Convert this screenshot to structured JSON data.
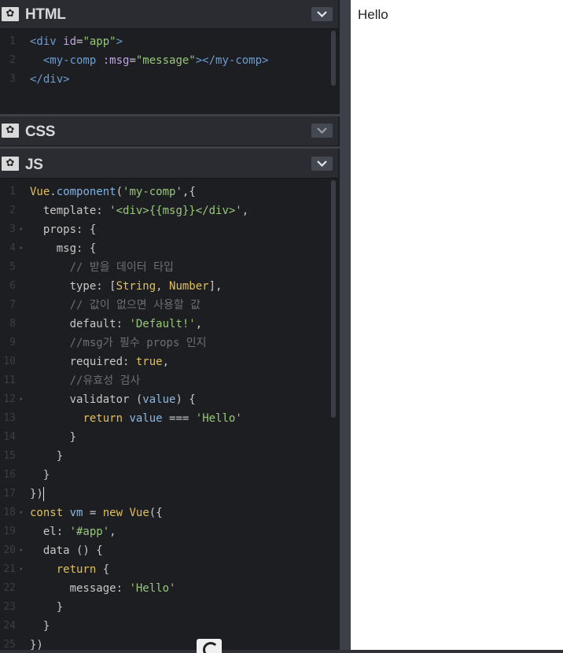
{
  "panels": {
    "html": {
      "title": "HTML"
    },
    "css": {
      "title": "CSS"
    },
    "js": {
      "title": "JS"
    }
  },
  "icons": {
    "settings": "gear-icon",
    "collapse": "chevron-down-icon"
  },
  "html_code": [
    {
      "n": "1",
      "parts": [
        [
          "t-tag",
          "<div "
        ],
        [
          "t-attr",
          "id"
        ],
        [
          "t-plain",
          "="
        ],
        [
          "t-str",
          "\"app\""
        ],
        [
          "t-tag",
          ">"
        ]
      ]
    },
    {
      "n": "2",
      "parts": [
        [
          "t-plain",
          "  "
        ],
        [
          "t-tag",
          "<my-comp "
        ],
        [
          "t-attr",
          ":msg"
        ],
        [
          "t-plain",
          "="
        ],
        [
          "t-str",
          "\"message\""
        ],
        [
          "t-tag",
          ">"
        ],
        [
          "t-tag",
          "</my-comp>"
        ]
      ]
    },
    {
      "n": "3",
      "parts": [
        [
          "t-tag",
          "</div>"
        ]
      ]
    }
  ],
  "js_code": [
    {
      "n": "1",
      "fold": "",
      "parts": [
        [
          "t-kw",
          "Vue"
        ],
        [
          "t-plain",
          "."
        ],
        [
          "t-fn",
          "component"
        ],
        [
          "t-plain",
          "("
        ],
        [
          "t-str",
          "'my-comp'"
        ],
        [
          "t-plain",
          ",{"
        ]
      ]
    },
    {
      "n": "2",
      "fold": "",
      "parts": [
        [
          "t-plain",
          "  template: "
        ],
        [
          "t-str",
          "'<div>{{msg}}</div>'"
        ],
        [
          "t-plain",
          ","
        ]
      ]
    },
    {
      "n": "3",
      "fold": "▾",
      "parts": [
        [
          "t-plain",
          "  props: {"
        ]
      ]
    },
    {
      "n": "4",
      "fold": "▾",
      "parts": [
        [
          "t-plain",
          "    msg: {"
        ]
      ]
    },
    {
      "n": "5",
      "fold": "",
      "parts": [
        [
          "t-com",
          "      // 받을 데이터 타입"
        ]
      ]
    },
    {
      "n": "6",
      "fold": "",
      "parts": [
        [
          "t-plain",
          "      type: ["
        ],
        [
          "t-kw",
          "String"
        ],
        [
          "t-plain",
          ", "
        ],
        [
          "t-kw",
          "Number"
        ],
        [
          "t-plain",
          "],"
        ]
      ]
    },
    {
      "n": "7",
      "fold": "",
      "parts": [
        [
          "t-com",
          "      // 값이 없으면 사용할 값"
        ]
      ]
    },
    {
      "n": "8",
      "fold": "",
      "parts": [
        [
          "t-plain",
          "      default: "
        ],
        [
          "t-str",
          "'Default!'"
        ],
        [
          "t-plain",
          ","
        ]
      ]
    },
    {
      "n": "9",
      "fold": "",
      "parts": [
        [
          "t-com",
          "      //msg가 필수 props 인지"
        ]
      ]
    },
    {
      "n": "10",
      "fold": "",
      "parts": [
        [
          "t-plain",
          "      required: "
        ],
        [
          "t-kw",
          "true"
        ],
        [
          "t-plain",
          ","
        ]
      ]
    },
    {
      "n": "11",
      "fold": "",
      "parts": [
        [
          "t-com",
          "      //유효성 검사"
        ]
      ]
    },
    {
      "n": "12",
      "fold": "▾",
      "parts": [
        [
          "t-plain",
          "      validator ("
        ],
        [
          "t-var",
          "value"
        ],
        [
          "t-plain",
          ") {"
        ]
      ]
    },
    {
      "n": "13",
      "fold": "",
      "parts": [
        [
          "t-plain",
          "        "
        ],
        [
          "t-kw",
          "return"
        ],
        [
          "t-plain",
          " "
        ],
        [
          "t-var",
          "value"
        ],
        [
          "t-plain",
          " === "
        ],
        [
          "t-str",
          "'Hello'"
        ]
      ]
    },
    {
      "n": "14",
      "fold": "",
      "parts": [
        [
          "t-plain",
          "      }"
        ]
      ]
    },
    {
      "n": "15",
      "fold": "",
      "parts": [
        [
          "t-plain",
          "    }"
        ]
      ]
    },
    {
      "n": "16",
      "fold": "",
      "parts": [
        [
          "t-plain",
          "  }"
        ]
      ]
    },
    {
      "n": "17",
      "fold": "",
      "parts": [
        [
          "t-plain",
          "})"
        ]
      ],
      "cursor": true
    },
    {
      "n": "18",
      "fold": "▾",
      "parts": [
        [
          "t-kw",
          "const"
        ],
        [
          "t-plain",
          " "
        ],
        [
          "t-var",
          "vm"
        ],
        [
          "t-plain",
          " = "
        ],
        [
          "t-kw",
          "new"
        ],
        [
          "t-plain",
          " "
        ],
        [
          "t-kw",
          "Vue"
        ],
        [
          "t-plain",
          "({"
        ]
      ]
    },
    {
      "n": "19",
      "fold": "",
      "parts": [
        [
          "t-plain",
          "  el: "
        ],
        [
          "t-str",
          "'#app'"
        ],
        [
          "t-plain",
          ","
        ]
      ]
    },
    {
      "n": "20",
      "fold": "▾",
      "parts": [
        [
          "t-plain",
          "  data () {"
        ]
      ]
    },
    {
      "n": "21",
      "fold": "▾",
      "parts": [
        [
          "t-plain",
          "    "
        ],
        [
          "t-kw",
          "return"
        ],
        [
          "t-plain",
          " {"
        ]
      ]
    },
    {
      "n": "22",
      "fold": "",
      "parts": [
        [
          "t-plain",
          "      message: "
        ],
        [
          "t-str",
          "'Hello'"
        ]
      ]
    },
    {
      "n": "23",
      "fold": "",
      "parts": [
        [
          "t-plain",
          "    }"
        ]
      ]
    },
    {
      "n": "24",
      "fold": "",
      "parts": [
        [
          "t-plain",
          "  }"
        ]
      ]
    },
    {
      "n": "25",
      "fold": "",
      "parts": [
        [
          "t-plain",
          "})"
        ]
      ]
    }
  ],
  "preview": {
    "output": "Hello"
  }
}
